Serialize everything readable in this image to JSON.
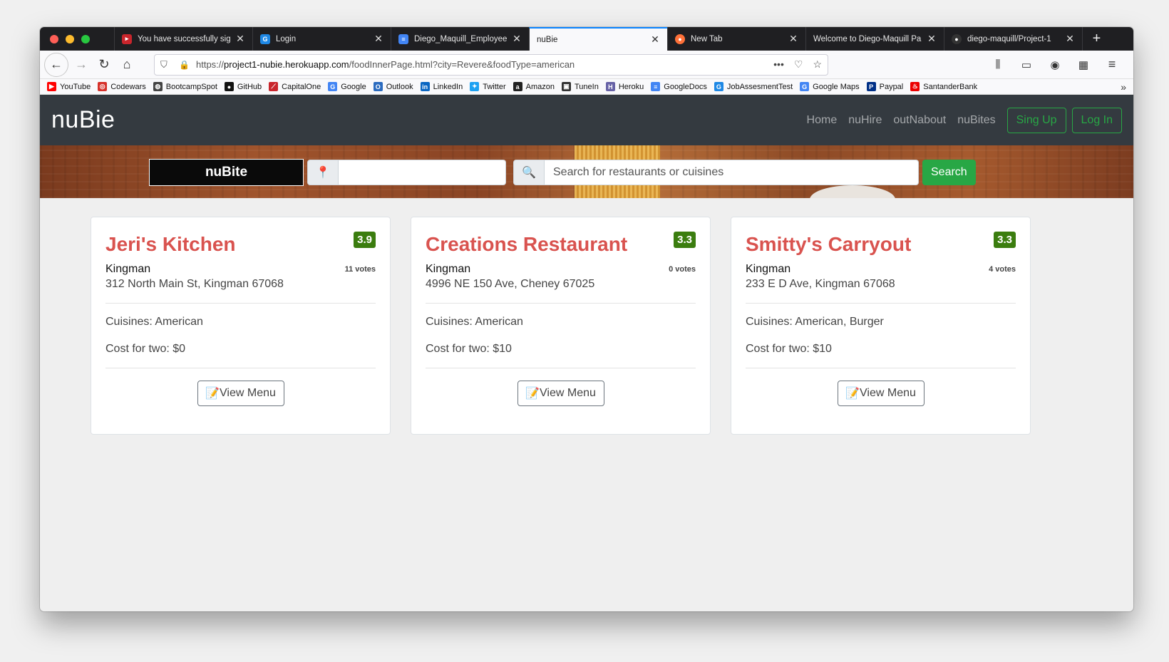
{
  "browser": {
    "tabs": [
      {
        "title": "You have successfully sig",
        "icon": "capitalone-icon",
        "active": false
      },
      {
        "title": "Login",
        "icon": "g-logo-icon",
        "active": false
      },
      {
        "title": "Diego_Maquill_Employee",
        "icon": "docs-icon",
        "active": false
      },
      {
        "title": "nuBie",
        "icon": "",
        "active": true
      },
      {
        "title": "New Tab",
        "icon": "firefox-icon",
        "active": false
      },
      {
        "title": "Welcome to Diego-Maquill Pa",
        "icon": "",
        "active": false
      },
      {
        "title": "diego-maquill/Project-1",
        "icon": "github-icon",
        "active": false
      }
    ],
    "url_prefix": "https://",
    "url_host": "project1-nubie.herokuapp.com",
    "url_path": "/foodInnerPage.html?city=Revere&foodType=american",
    "bookmarks": [
      {
        "label": "YouTube",
        "icon": "youtube-icon",
        "color": "#ff0000"
      },
      {
        "label": "Codewars",
        "icon": "codewars-icon",
        "color": "#d6312a"
      },
      {
        "label": "BootcampSpot",
        "icon": "globe-icon",
        "color": "#444444"
      },
      {
        "label": "GitHub",
        "icon": "github-icon",
        "color": "#111111"
      },
      {
        "label": "CapitalOne",
        "icon": "capitalone-icon",
        "color": "#c9252c"
      },
      {
        "label": "Google",
        "icon": "google-icon",
        "color": "#4285f4"
      },
      {
        "label": "Outlook",
        "icon": "outlook-icon",
        "color": "#2b6bbf"
      },
      {
        "label": "LinkedIn",
        "icon": "linkedin-icon",
        "color": "#0a66c2"
      },
      {
        "label": "Twitter",
        "icon": "twitter-icon",
        "color": "#1da1f2"
      },
      {
        "label": "Amazon",
        "icon": "amazon-icon",
        "color": "#222222"
      },
      {
        "label": "TuneIn",
        "icon": "tunein-icon",
        "color": "#333333"
      },
      {
        "label": "Heroku",
        "icon": "heroku-icon",
        "color": "#6762a6"
      },
      {
        "label": "GoogleDocs",
        "icon": "docs-icon",
        "color": "#4285f4"
      },
      {
        "label": "JobAssesmentTest",
        "icon": "g-logo-icon",
        "color": "#1e88e5"
      },
      {
        "label": "Google Maps",
        "icon": "google-icon",
        "color": "#4285f4"
      },
      {
        "label": "Paypal",
        "icon": "paypal-icon",
        "color": "#003087"
      },
      {
        "label": "SantanderBank",
        "icon": "santander-icon",
        "color": "#ec0000"
      }
    ]
  },
  "navbar": {
    "brand": "nuBie",
    "links": [
      "Home",
      "nuHire",
      "outNabout",
      "nuBites"
    ],
    "signup_label": "Sing Up",
    "login_label": "Log In"
  },
  "search": {
    "section_label": "nuBite",
    "location_value": "",
    "placeholder": "Search for restaurants or cuisines",
    "button_label": "Search"
  },
  "restaurants": [
    {
      "name": "Jeri's Kitchen",
      "rating": "3.9",
      "votes": "11 votes",
      "city": "Kingman",
      "address": "312 North Main St, Kingman 67068",
      "cuisines": "Cuisines: American",
      "cost": "Cost for two: $0",
      "menu_label": "View Menu"
    },
    {
      "name": "Creations Restaurant",
      "rating": "3.3",
      "votes": "0 votes",
      "city": "Kingman",
      "address": "4996 NE 150 Ave, Cheney 67025",
      "cuisines": "Cuisines: American",
      "cost": "Cost for two: $10",
      "menu_label": "View Menu"
    },
    {
      "name": "Smitty's Carryout",
      "rating": "3.3",
      "votes": "4 votes",
      "city": "Kingman",
      "address": "233 E D Ave, Kingman 67068",
      "cuisines": "Cuisines: American, Burger",
      "cost": "Cost for two: $10",
      "menu_label": "View Menu"
    }
  ],
  "colors": {
    "navbar_bg": "#343a40",
    "accent_green": "#28a745",
    "restaurant_name": "#d9534f",
    "rating_badge": "#3b7d0f"
  }
}
